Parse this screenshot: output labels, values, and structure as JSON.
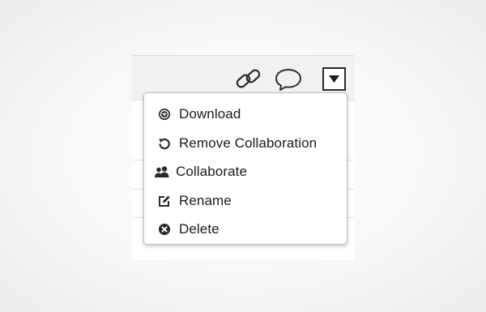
{
  "toolbar": {
    "icons": [
      "link-icon",
      "comment-icon",
      "caret-down-icon"
    ]
  },
  "menu": {
    "items": [
      {
        "label": "Download",
        "icon": "download-icon"
      },
      {
        "label": "Remove Collaboration",
        "icon": "undo-icon"
      },
      {
        "label": "Collaborate",
        "icon": "users-icon"
      },
      {
        "label": "Rename",
        "icon": "edit-icon"
      },
      {
        "label": "Delete",
        "icon": "delete-icon"
      }
    ]
  },
  "colors": {
    "text": "#1b1b1b",
    "icon": "#2a2a2a",
    "menu_border": "#bdbdbd",
    "toolbar_bg": "#f1f1f1"
  }
}
